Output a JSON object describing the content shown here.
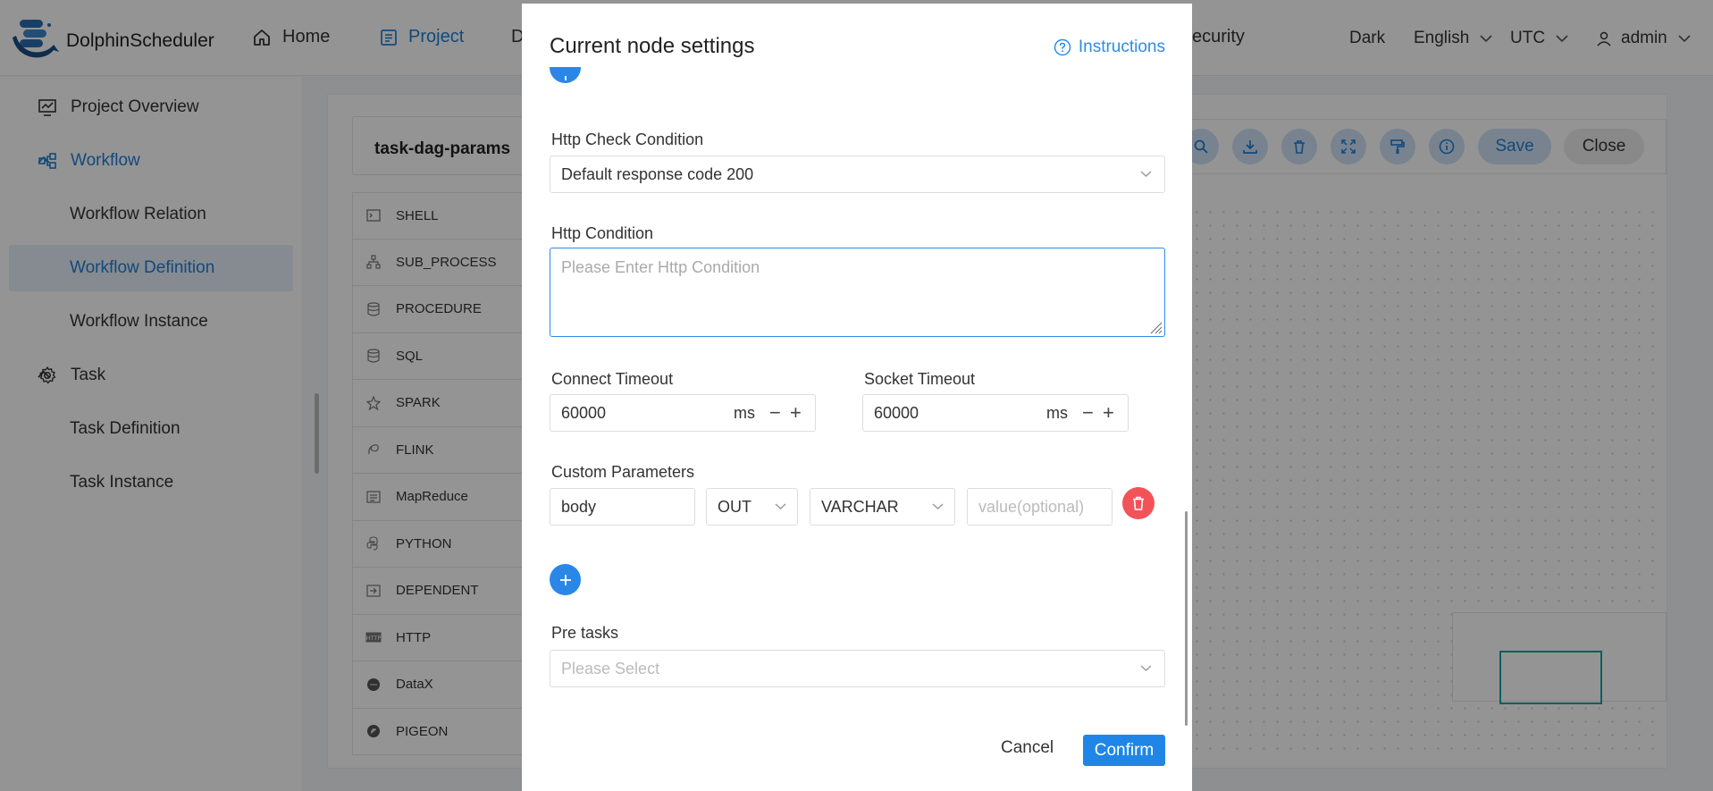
{
  "header": {
    "app_name": "DolphinScheduler",
    "nav": [
      {
        "label": "Home"
      },
      {
        "label": "Project"
      },
      {
        "label": "D"
      },
      {
        "label": "ecurity"
      }
    ],
    "theme_label": "Dark",
    "language_label": "English",
    "timezone_label": "UTC",
    "user_label": "admin"
  },
  "sidebar": {
    "items": [
      {
        "label": "Project Overview"
      },
      {
        "label": "Workflow"
      },
      {
        "label": "Workflow Relation"
      },
      {
        "label": "Workflow Definition"
      },
      {
        "label": "Workflow Instance"
      },
      {
        "label": "Task"
      },
      {
        "label": "Task Definition"
      },
      {
        "label": "Task Instance"
      }
    ],
    "selected": "Workflow Definition"
  },
  "dag": {
    "title": "task-dag-params",
    "tools": [
      "SHELL",
      "SUB_PROCESS",
      "PROCEDURE",
      "SQL",
      "SPARK",
      "FLINK",
      "MapReduce",
      "PYTHON",
      "DEPENDENT",
      "HTTP",
      "DataX",
      "PIGEON"
    ],
    "toolbar": {
      "save_label": "Save",
      "close_label": "Close"
    }
  },
  "modal": {
    "title": "Current node settings",
    "instructions_label": "Instructions",
    "http_check_condition": {
      "label": "Http Check Condition",
      "value": "Default response code 200"
    },
    "http_condition": {
      "label": "Http Condition",
      "placeholder": "Please Enter Http Condition"
    },
    "connect_timeout": {
      "label": "Connect Timeout",
      "value": "60000",
      "unit": "ms"
    },
    "socket_timeout": {
      "label": "Socket Timeout",
      "value": "60000",
      "unit": "ms"
    },
    "custom_parameters": {
      "label": "Custom Parameters",
      "rows": [
        {
          "prop": "body",
          "direct": "OUT",
          "type": "VARCHAR",
          "value_placeholder": "value(optional)"
        }
      ]
    },
    "pre_tasks": {
      "label": "Pre tasks",
      "placeholder": "Please Select"
    },
    "cancel_label": "Cancel",
    "confirm_label": "Confirm"
  },
  "colors": {
    "accent": "#1f86e8",
    "delete": "#f25359",
    "selected_bg": "#e6f0fa"
  }
}
